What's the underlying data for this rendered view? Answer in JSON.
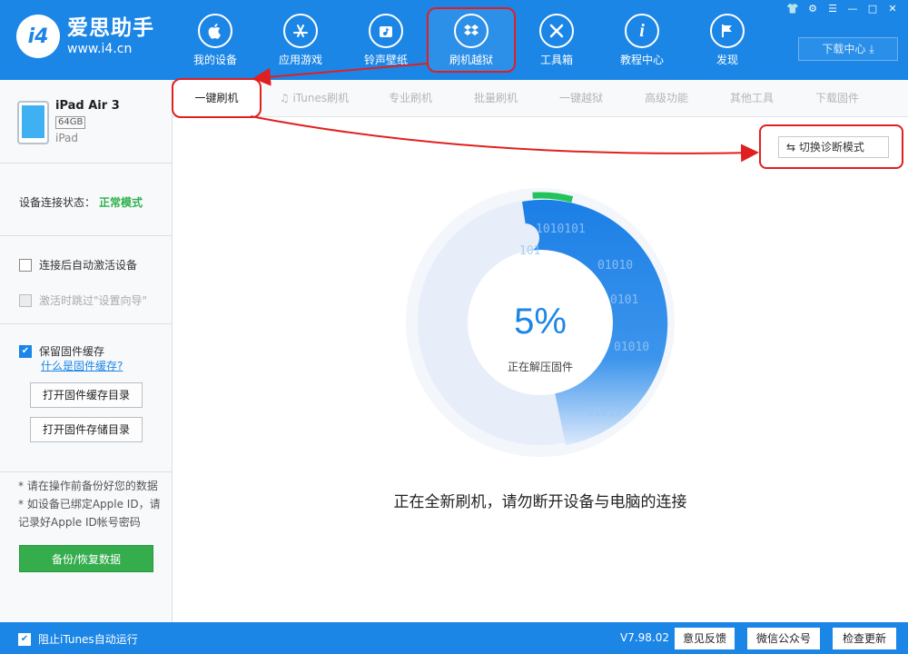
{
  "app": {
    "logo_mark": "i4",
    "name": "爱思助手",
    "url": "www.i4.cn"
  },
  "nav": [
    {
      "label": "我的设备",
      "icon": "apple-icon"
    },
    {
      "label": "应用游戏",
      "icon": "app-store-icon"
    },
    {
      "label": "铃声壁纸",
      "icon": "ringtone-icon"
    },
    {
      "label": "刷机越狱",
      "icon": "dropbox-icon"
    },
    {
      "label": "工具箱",
      "icon": "toolbox-icon"
    },
    {
      "label": "教程中心",
      "icon": "info-icon"
    },
    {
      "label": "发现",
      "icon": "flag-icon"
    }
  ],
  "download_center": "下载中心",
  "sidebar": {
    "device_name": "iPad Air 3",
    "capacity": "64GB",
    "device_type": "iPad",
    "conn_label": "设备连接状态：",
    "conn_mode": "正常模式",
    "auto_activate": "连接后自动激活设备",
    "skip_setup": "激活时跳过\"设置向导\"",
    "keep_cache": "保留固件缓存",
    "what_cache": "什么是固件缓存?",
    "open_cache_dir": "打开固件缓存目录",
    "open_store_dir": "打开固件存储目录",
    "note1": "* 请在操作前备份好您的数据",
    "note2": "* 如设备已绑定Apple ID，请记录好Apple ID帐号密码",
    "backup_btn": "备份/恢复数据"
  },
  "tabs": [
    "一键刷机",
    "iTunes刷机",
    "专业刷机",
    "批量刷机",
    "一键越狱",
    "高级功能",
    "其他工具",
    "下载固件"
  ],
  "diag_button": "切换诊断模式",
  "progress": {
    "percent_text": "5%",
    "value": 0.05,
    "status": "正在解压固件",
    "message": "正在全新刷机，请勿断开设备与电脑的连接"
  },
  "footer": {
    "block_itunes": "阻止iTunes自动运行",
    "version": "V7.98.02",
    "feedback": "意见反馈",
    "wechat": "微信公众号",
    "update": "检查更新"
  },
  "colors": {
    "brand": "#1b86e6",
    "success": "#2db14a",
    "highlight": "#e02020"
  }
}
